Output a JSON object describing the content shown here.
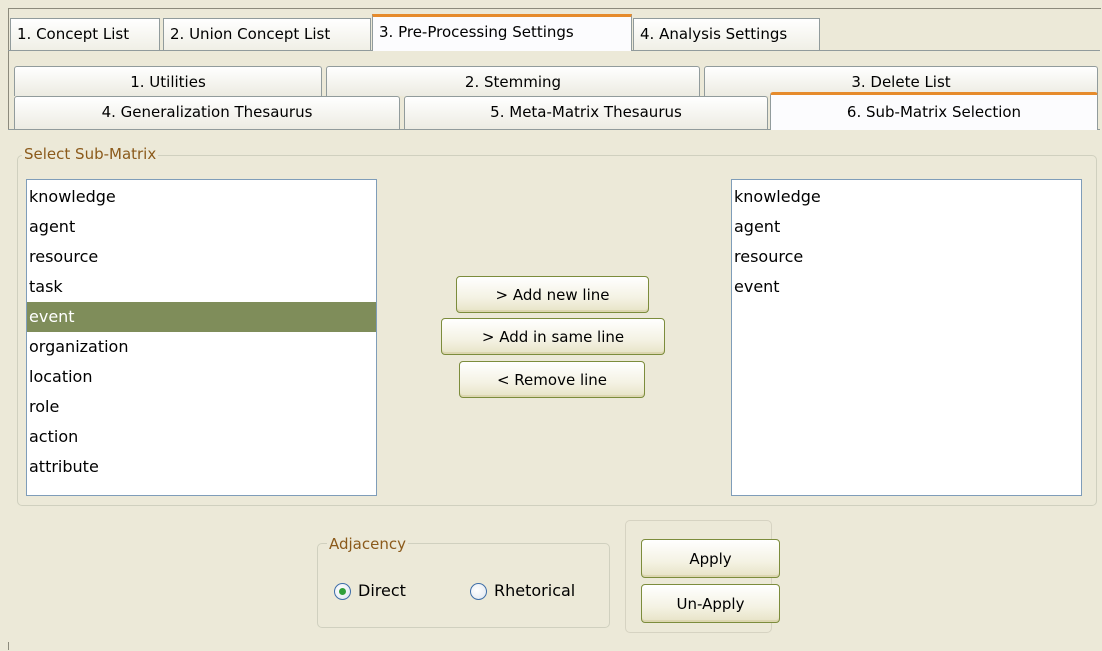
{
  "top_tabs": [
    "1. Concept List",
    "2. Union Concept List",
    "3. Pre-Processing Settings",
    "4. Analysis Settings"
  ],
  "sub_tabs": {
    "row1": [
      "1. Utilities",
      "2. Stemming",
      "3. Delete List"
    ],
    "row2": [
      "4. Generalization Thesaurus",
      "5. Meta-Matrix Thesaurus",
      "6. Sub-Matrix Selection"
    ]
  },
  "select_group": {
    "legend": "Select Sub-Matrix",
    "left_items": [
      "knowledge",
      "agent",
      "resource",
      "task",
      "event",
      "organization",
      "location",
      "role",
      "action",
      "attribute"
    ],
    "selected_left": "event",
    "right_items": [
      "knowledge",
      "agent",
      "resource",
      "event"
    ],
    "buttons": {
      "add_new": "> Add new line",
      "add_same": "> Add in same line",
      "remove": "< Remove line"
    }
  },
  "adjacency": {
    "legend": "Adjacency",
    "options": [
      "Direct",
      "Rhetorical"
    ],
    "selected": "Direct"
  },
  "apply_buttons": {
    "apply": "Apply",
    "unapply": "Un-Apply"
  },
  "colors": {
    "active_tab_accent": "#E68B2C",
    "selection": "#7F8D5A",
    "legend_text": "#8B5A1B"
  }
}
